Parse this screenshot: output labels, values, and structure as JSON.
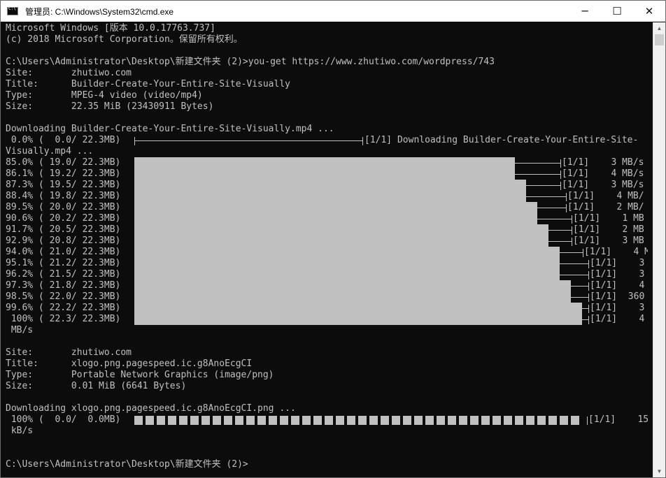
{
  "window": {
    "title": "管理员: C:\\Windows\\System32\\cmd.exe",
    "minimize_glyph": "─",
    "maximize_glyph": "☐",
    "close_glyph": "✕"
  },
  "console": {
    "lines": [
      "Microsoft Windows [版本 10.0.17763.737]",
      "(c) 2018 Microsoft Corporation。保留所有权利。",
      "",
      "C:\\Users\\Administrator\\Desktop\\新建文件夹 (2)>you-get https://www.zhutiwo.com/wordpress/743",
      "Site:       zhutiwo.com",
      "Title:      Builder-Create-Your-Entire-Site-Visually",
      "Type:       MPEG-4 video (video/mp4)",
      "Size:       22.35 MiB (23430911 Bytes)",
      "",
      "Downloading Builder-Create-Your-Entire-Site-Visually.mp4 ...",
      " 0.0% (  0.0/ 22.3MB)",
      "Visually.mp4 ..."
    ],
    "first_progress_tail": "[1/1] Downloading Builder-Create-Your-Entire-Site-",
    "progress_rows": [
      {
        "left": "85.0% ( 19.0/ 22.3MB)",
        "right": "[1/1]    3 MB/s"
      },
      {
        "left": "86.1% ( 19.2/ 22.3MB)",
        "right": "[1/1]    4 MB/s"
      },
      {
        "left": "87.3% ( 19.5/ 22.3MB)",
        "right": "[1/1]    3 MB/s"
      },
      {
        "left": "88.4% ( 19.8/ 22.3MB)",
        "right": "[1/1]    4 MB/"
      },
      {
        "left": "89.5% ( 20.0/ 22.3MB)",
        "right": "[1/1]    2 MB/"
      },
      {
        "left": "90.6% ( 20.2/ 22.3MB)",
        "right": "[1/1]    1 MB"
      },
      {
        "left": "91.7% ( 20.5/ 22.3MB)",
        "right": "[1/1]    2 MB"
      },
      {
        "left": "92.9% ( 20.8/ 22.3MB)",
        "right": "[1/1]    3 MB"
      },
      {
        "left": "94.0% ( 21.0/ 22.3MB)",
        "right": "[1/1]    4 M"
      },
      {
        "left": "95.1% ( 21.2/ 22.3MB)",
        "right": "[1/1]    3"
      },
      {
        "left": "96.2% ( 21.5/ 22.3MB)",
        "right": "[1/1]    3"
      },
      {
        "left": "97.3% ( 21.8/ 22.3MB)",
        "right": "[1/1]    4"
      },
      {
        "left": "98.5% ( 22.0/ 22.3MB)",
        "right": "[1/1]  360"
      },
      {
        "left": "99.6% ( 22.2/ 22.3MB)",
        "right": "[1/1]    3"
      },
      {
        "left": " 100% ( 22.3/ 22.3MB)",
        "right": "[1/1]    4"
      }
    ],
    "after_rows": [
      " MB/s",
      "",
      "Site:       zhutiwo.com",
      "Title:      xlogo.png.pagespeed.ic.g8AnoEcgCI",
      "Type:       Portable Network Graphics (image/png)",
      "Size:       0.01 MiB (6641 Bytes)",
      "",
      "Downloading xlogo.png.pagespeed.ic.g8AnoEcgCI.png ...",
      " 100% (  0.0/  0.0MB)",
      " kB/s",
      "",
      "",
      "C:\\Users\\Administrator\\Desktop\\新建文件夹 (2)>"
    ],
    "second_progress_tail": "[1/1]    15"
  },
  "scrollbar": {
    "up_glyph": "▲",
    "down_glyph": "▼"
  }
}
